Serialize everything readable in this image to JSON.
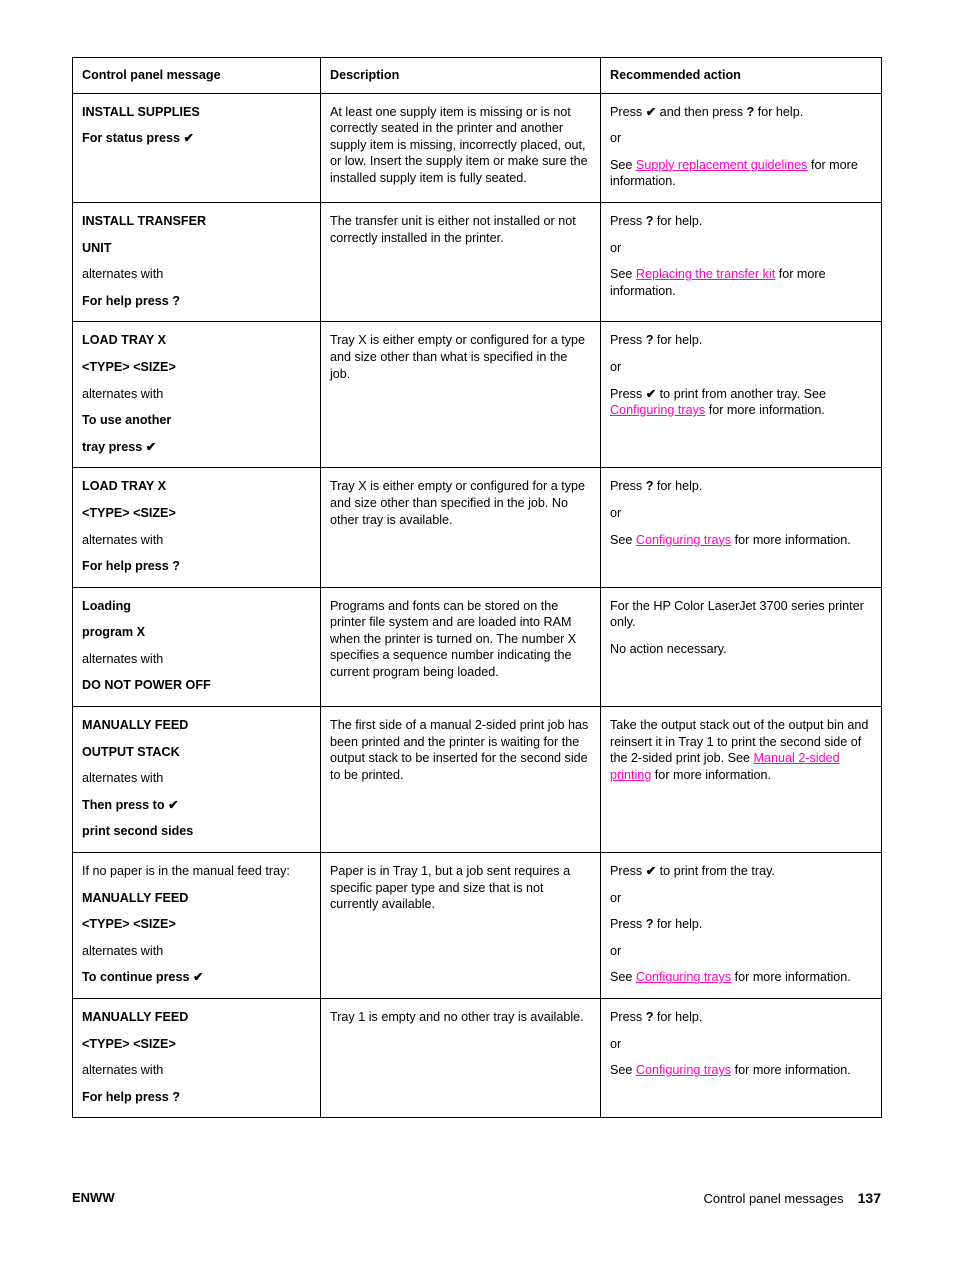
{
  "document": {
    "page_number": "137",
    "footer_left": "ENWW",
    "footer_section": "Control panel messages"
  },
  "glyphs": {
    "check": "✔",
    "help": "?"
  },
  "colors": {
    "link": "#ff00cc",
    "border": "#000000",
    "text": "#000000"
  },
  "table": {
    "headers": {
      "message": "Control panel message",
      "description": "Description",
      "action": "Recommended action"
    },
    "rows": [
      {
        "message_lines": [
          {
            "text": "INSTALL SUPPLIES",
            "style": "bold"
          },
          {
            "text": "For status press ✔",
            "style": "bold"
          }
        ],
        "description": "At least one supply item is missing or is not correctly seated in the printer and another supply item is missing, incorrectly placed, out, or low. Insert the supply item or make sure the installed supply item is fully seated.",
        "action_parts": [
          {
            "text": "Press ✔ and then press ? for help."
          },
          {
            "text": "or"
          },
          {
            "pre": "See ",
            "link": "Supply replacement guidelines",
            "post": " for more information."
          }
        ]
      },
      {
        "message_lines": [
          {
            "text": "INSTALL TRANSFER",
            "style": "bold"
          },
          {
            "text": "UNIT",
            "style": "bold"
          },
          {
            "text": "alternates with",
            "style": "normal"
          },
          {
            "text": "For help press ?",
            "style": "bold"
          }
        ],
        "description": "The transfer unit is either not installed or not correctly installed in the printer.",
        "action_parts": [
          {
            "text": "Press ? for help."
          },
          {
            "text": "or"
          },
          {
            "pre": "See ",
            "link": "Replacing the transfer kit",
            "post": " for more information."
          }
        ]
      },
      {
        "message_lines": [
          {
            "text": "LOAD TRAY X",
            "style": "bold"
          },
          {
            "text": "<TYPE> <SIZE>",
            "style": "bold"
          },
          {
            "text": "alternates with",
            "style": "normal"
          },
          {
            "text": "To use another",
            "style": "bold"
          },
          {
            "text": "tray press ✔",
            "style": "bold"
          }
        ],
        "description": "Tray X is either empty or configured for a type and size other than what is specified in the job.",
        "action_parts": [
          {
            "text": "Press ? for help."
          },
          {
            "text": "or"
          },
          {
            "pre": "Press ✔ to print from another tray. See ",
            "link": "Configuring trays",
            "post": " for more information."
          }
        ]
      },
      {
        "message_lines": [
          {
            "text": "LOAD TRAY X",
            "style": "bold"
          },
          {
            "text": "<TYPE> <SIZE>",
            "style": "bold"
          },
          {
            "text": "alternates with",
            "style": "normal"
          },
          {
            "text": "For help press ?",
            "style": "bold"
          }
        ],
        "description": "Tray X is either empty or configured for a type and size other than specified in the job. No other tray is available.",
        "action_parts": [
          {
            "text": "Press ? for help."
          },
          {
            "text": "or"
          },
          {
            "pre": "See ",
            "link": "Configuring trays",
            "post": " for more information."
          }
        ]
      },
      {
        "message_lines": [
          {
            "text": "Loading",
            "style": "bold"
          },
          {
            "text": "program X",
            "style": "bold"
          },
          {
            "text": "alternates with",
            "style": "normal"
          },
          {
            "text": "DO NOT POWER OFF",
            "style": "bold"
          }
        ],
        "description": "Programs and fonts can be stored on the printer file system and are loaded into RAM when the printer is turned on. The number X specifies a sequence number indicating the current program being loaded.",
        "action_parts": [
          {
            "text": "For the HP Color LaserJet 3700 series printer only."
          },
          {
            "text": "No action necessary."
          }
        ]
      },
      {
        "message_lines": [
          {
            "text": "MANUALLY FEED",
            "style": "bold"
          },
          {
            "text": "OUTPUT STACK",
            "style": "bold"
          },
          {
            "text": "alternates with",
            "style": "normal"
          },
          {
            "text": "Then press to ✔",
            "style": "bold"
          },
          {
            "text": "print second sides",
            "style": "bold"
          }
        ],
        "description": "The first side of a manual 2-sided print job has been printed and the printer is waiting for the output stack to be inserted for the second side to be printed.",
        "action_parts": [
          {
            "pre": "Take the output stack out of the output bin and reinsert it in Tray 1 to print the second side of the 2-sided print job. See ",
            "link": "Manual 2-sided printing",
            "post": " for more information."
          }
        ]
      },
      {
        "message_lines": [
          {
            "text": "If no paper is in the manual feed tray:",
            "style": "normal"
          },
          {
            "text": "MANUALLY FEED",
            "style": "bold"
          },
          {
            "text": "<TYPE> <SIZE>",
            "style": "bold"
          },
          {
            "text": "alternates with",
            "style": "normal"
          },
          {
            "text": "To continue press ✔",
            "style": "bold"
          }
        ],
        "description": "Paper is in Tray 1, but a job sent requires a specific paper type and size that is not currently available.",
        "action_parts": [
          {
            "text": "Press ✔ to print from the tray."
          },
          {
            "text": "or"
          },
          {
            "text": "Press ? for help."
          },
          {
            "text": "or"
          },
          {
            "pre": "See ",
            "link": "Configuring trays",
            "post": " for more information."
          }
        ]
      },
      {
        "message_lines": [
          {
            "text": "MANUALLY FEED",
            "style": "bold"
          },
          {
            "text": "<TYPE> <SIZE>",
            "style": "bold"
          },
          {
            "text": "alternates with",
            "style": "normal"
          },
          {
            "text": "For help press ?",
            "style": "bold"
          }
        ],
        "description": "Tray 1 is empty and no other tray is available.",
        "action_parts": [
          {
            "text": "Press ? for help."
          },
          {
            "text": "or"
          },
          {
            "pre": "See ",
            "link": "Configuring trays",
            "post": " for more information."
          }
        ]
      }
    ]
  }
}
